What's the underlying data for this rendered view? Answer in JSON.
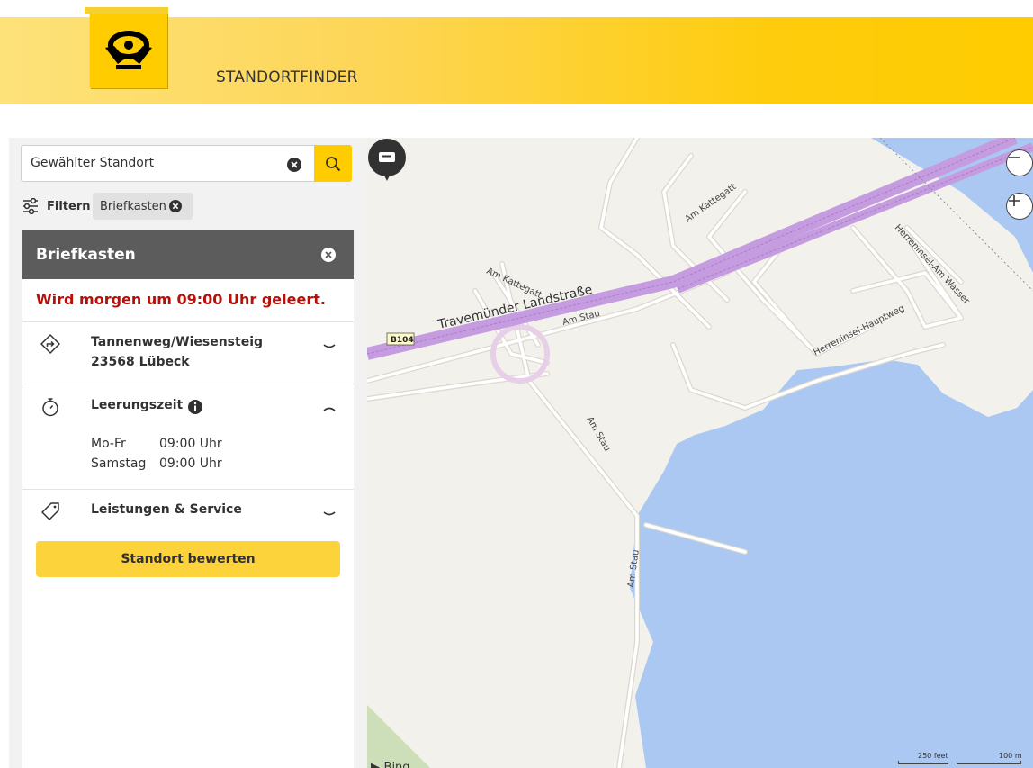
{
  "header": {
    "app_title": "STANDORTFINDER",
    "logo_name": "post-horn-logo",
    "brand_color": "#ffcc00"
  },
  "search": {
    "value": "Gewählter Standort",
    "placeholder": "Gewählter Standort"
  },
  "filter": {
    "label": "Filtern",
    "chips": [
      {
        "label": "Briefkasten"
      }
    ]
  },
  "detail": {
    "title": "Briefkasten",
    "alert": "Wird morgen um 09:00 Uhr geleert.",
    "alert_color": "#b70f0a",
    "address": {
      "street": "Tannenweg/Wiesensteig",
      "city": "23568 Lübeck"
    },
    "collection": {
      "title": "Leerungszeit",
      "rows": [
        {
          "days": "Mo-Fr",
          "time": "09:00 Uhr"
        },
        {
          "days": "Samstag",
          "time": "09:00 Uhr"
        }
      ]
    },
    "services": {
      "title": "Leistungen & Service"
    },
    "rate_button": "Standort bewerten"
  },
  "map": {
    "labels": {
      "main_road": "Travemünder Landstraße",
      "road_badge": "B104",
      "am_kattegatt_1": "Am Kattegatt",
      "am_kattegatt_2": "Am Kattegatt",
      "am_stau_1": "Am Stau",
      "am_stau_2": "Am Stau",
      "am_stau_3": "Am Stau",
      "hauptweg": "Herreninsel-Hauptweg",
      "am_wasser": "Herreninsel-Am Wasser"
    },
    "scale": {
      "imperial": "250 feet",
      "metric": "100 m"
    },
    "attribution": "Bing"
  }
}
